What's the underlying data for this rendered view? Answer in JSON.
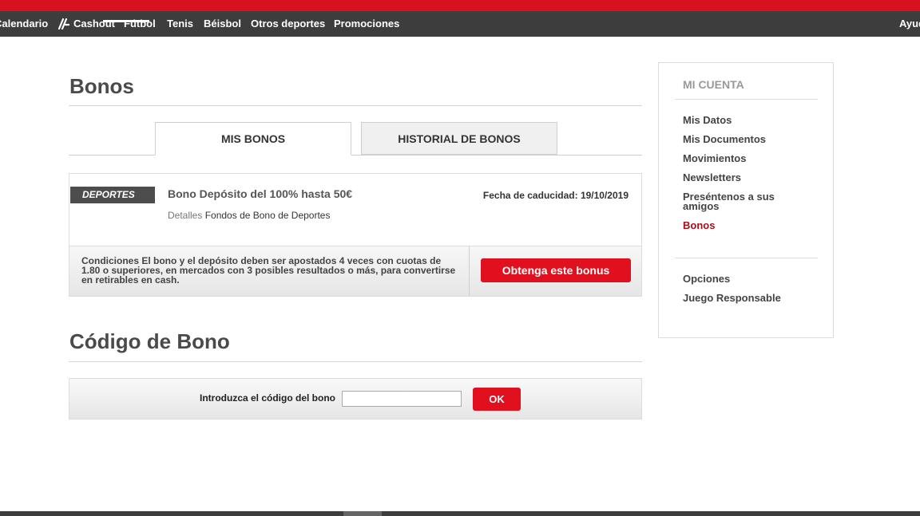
{
  "nav": {
    "items": [
      "Calendario",
      "Cashout",
      "Fútbol",
      "Tenis",
      "Béisbol",
      "Otros deportes",
      "Promociones"
    ],
    "help": "Ayuda"
  },
  "bonos": {
    "title": "Bonos",
    "tabs": [
      "MIS BONOS",
      "HISTORIAL DE BONOS"
    ],
    "card": {
      "badge": "DEPORTES",
      "name": "Bono Depósito del 100% hasta 50€",
      "details_label": "Detalles",
      "details_value": "Fondos de Bono de Deportes",
      "expiry": "Fecha de caducidad: 19/10/2019",
      "conditions": "Condiciones El bono y el depósito deben ser apostados 4 veces con cuotas de 1.80 o superiores, en mercados con 3 posibles resultados o más, para convertirse en retirables en cash.",
      "button": "Obtenga este bonus"
    }
  },
  "code": {
    "title": "Código de Bono",
    "label": "Introduzca el código del bono",
    "input_value": "",
    "button": "OK"
  },
  "sidebar": {
    "title": "MI CUENTA",
    "links": [
      "Mis Datos",
      "Mis Documentos",
      "Movimientos",
      "Newsletters",
      "Preséntenos a sus amigos",
      "Bonos"
    ],
    "active": "Bonos",
    "links2": [
      "Opciones",
      "Juego Responsable"
    ]
  },
  "colors": {
    "brand_red": "#d7121e",
    "nav_bg": "#3d3d3d",
    "button_red": "#e0101e",
    "active_link": "#a80f1a"
  }
}
